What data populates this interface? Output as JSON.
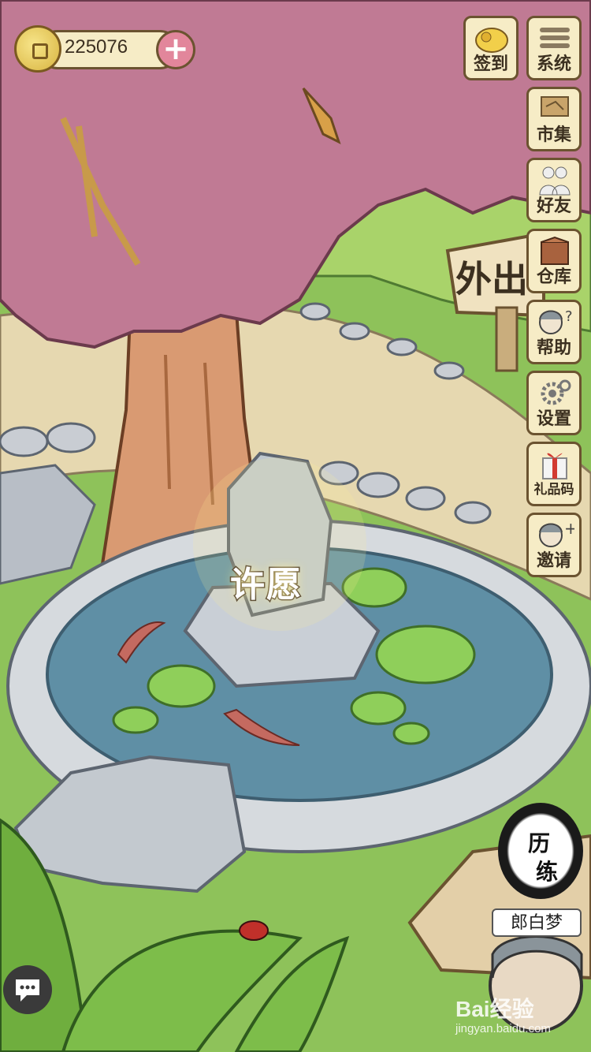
{
  "coin_bar": {
    "amount": "225076",
    "icon": "coin-icon",
    "add_icon": "plus-icon"
  },
  "side_menu": [
    {
      "label": "签到",
      "icon": "coins-bag-icon"
    },
    {
      "label": "系统",
      "icon": "menu-lines-icon"
    },
    {
      "label": "市集",
      "icon": "market-sign-icon"
    },
    {
      "label": "好友",
      "icon": "friends-icon"
    },
    {
      "label": "仓库",
      "icon": "box-icon"
    },
    {
      "label": "帮助",
      "icon": "help-character-icon"
    },
    {
      "label": "设置",
      "icon": "gears-icon"
    },
    {
      "label": "礼品码",
      "icon": "gift-icon"
    },
    {
      "label": "邀请",
      "icon": "invite-character-icon"
    }
  ],
  "scene": {
    "wish_label": "许愿",
    "sign_text": "外出"
  },
  "experience_button": {
    "line1": "历",
    "line2": "练"
  },
  "npc_name": "郎白梦",
  "chat_icon": "chat-bubble-icon",
  "watermark": {
    "brand": "Bai经验",
    "url": "jingyan.baidu.com"
  },
  "colors": {
    "tree_pink": "#c07a94",
    "grass": "#8ec25a",
    "path": "#e6d8b0",
    "water": "#5f8fa5",
    "button_bg": "#f6ecc6",
    "button_border": "#6b5330"
  }
}
